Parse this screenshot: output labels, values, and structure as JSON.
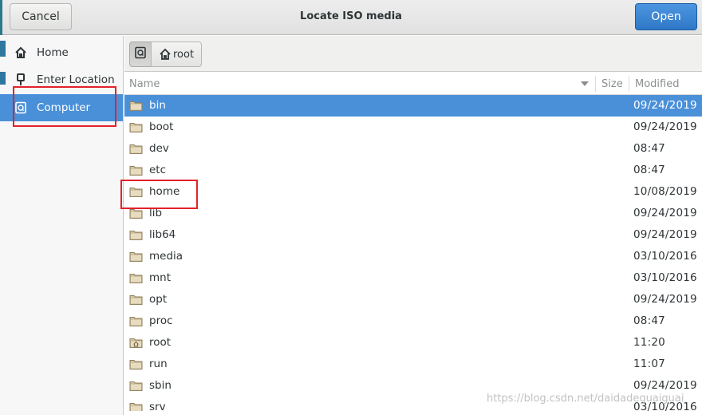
{
  "header": {
    "cancel_label": "Cancel",
    "title": "Locate ISO media",
    "open_label": "Open"
  },
  "sidebar": {
    "items": [
      {
        "label": "Home",
        "icon": "home-icon"
      },
      {
        "label": "Enter Location",
        "icon": "location-pin-icon"
      },
      {
        "label": "Computer",
        "icon": "computer-icon",
        "selected": true
      }
    ]
  },
  "pathbar": {
    "segments": [
      {
        "label": "",
        "icon": "computer-icon"
      },
      {
        "label": "root",
        "icon": "home-icon"
      }
    ]
  },
  "columns": {
    "name": "Name",
    "size": "Size",
    "modified": "Modified"
  },
  "files": [
    {
      "name": "bin",
      "size": "",
      "modified": "09/24/2019",
      "selected": true
    },
    {
      "name": "boot",
      "size": "",
      "modified": "09/24/2019"
    },
    {
      "name": "dev",
      "size": "",
      "modified": "08:47"
    },
    {
      "name": "etc",
      "size": "",
      "modified": "08:47"
    },
    {
      "name": "home",
      "size": "",
      "modified": "10/08/2019"
    },
    {
      "name": "lib",
      "size": "",
      "modified": "09/24/2019"
    },
    {
      "name": "lib64",
      "size": "",
      "modified": "09/24/2019"
    },
    {
      "name": "media",
      "size": "",
      "modified": "03/10/2016"
    },
    {
      "name": "mnt",
      "size": "",
      "modified": "03/10/2016"
    },
    {
      "name": "opt",
      "size": "",
      "modified": "09/24/2019"
    },
    {
      "name": "proc",
      "size": "",
      "modified": "08:47"
    },
    {
      "name": "root",
      "size": "",
      "modified": "11:20",
      "home_folder": true
    },
    {
      "name": "run",
      "size": "",
      "modified": "11:07"
    },
    {
      "name": "sbin",
      "size": "",
      "modified": "09/24/2019"
    },
    {
      "name": "srv",
      "size": "",
      "modified": "03/10/2016"
    }
  ],
  "watermark": "https://blog.csdn.net/daidadeguaiguai",
  "colors": {
    "accent": "#4a90d9",
    "annotation": "#e3222b"
  }
}
